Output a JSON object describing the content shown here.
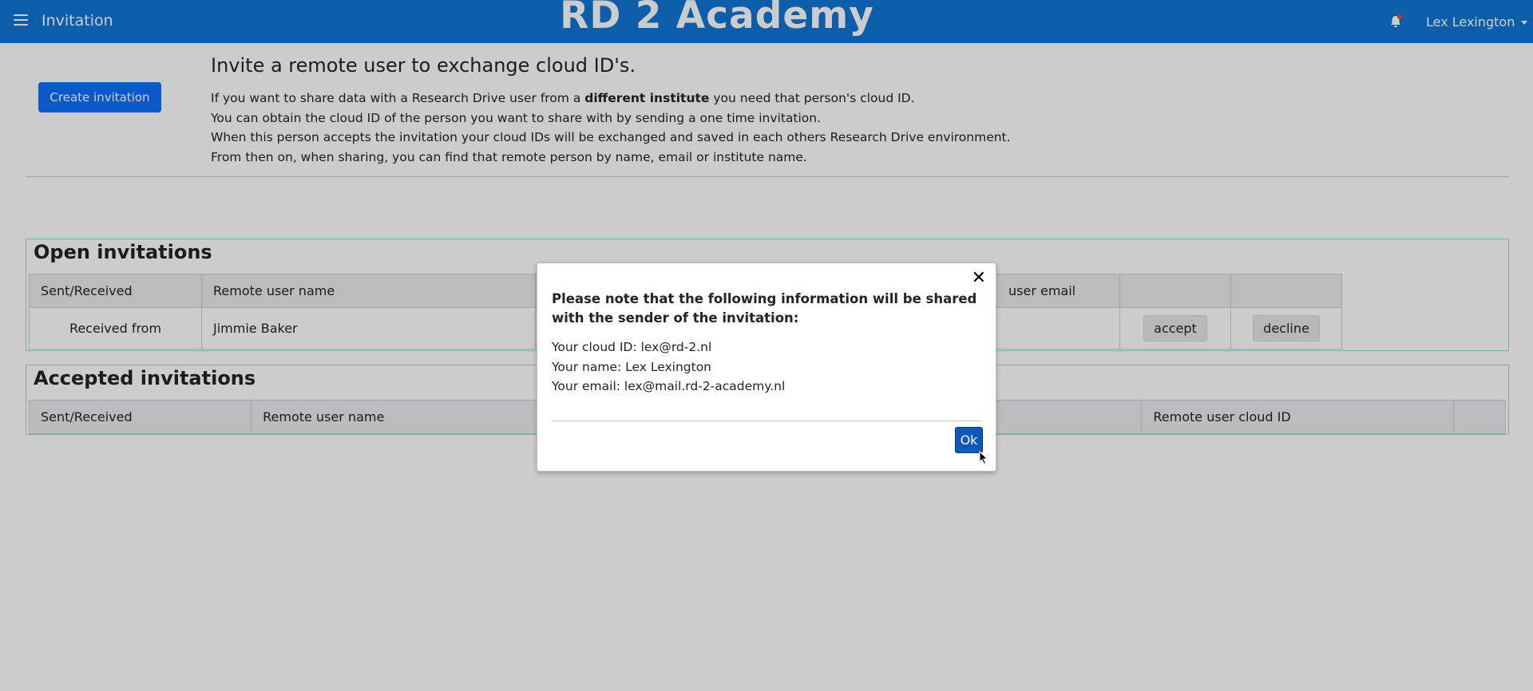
{
  "header": {
    "page_label": "Invitation",
    "brand": "RD 2 Academy",
    "user_name": "Lex Lexington",
    "icons": [
      "hamburger-menu-icon",
      "bell-icon"
    ]
  },
  "invite": {
    "create_button": "Create invitation",
    "title": "Invite a remote user to exchange cloud ID's.",
    "line1_prefix": "If you want to share data with a Research Drive user from a ",
    "line1_bold": "different institute",
    "line1_suffix": " you need that person's cloud ID.",
    "line2": "You can obtain the cloud ID of the person you want to share with by sending a one time invitation.",
    "line3": "When this person accepts the invitation your cloud IDs will be exchanged and saved in each others Research Drive environment.",
    "line4": "From then on, when sharing, you can find that remote person by name, email or institute name."
  },
  "open_invitations": {
    "title": "Open invitations",
    "columns": [
      "Sent/Received",
      "Remote user name",
      "user email",
      "",
      ""
    ],
    "rows": [
      {
        "direction": "Received from",
        "name": "Jimmie Baker",
        "email": "",
        "accept": "accept",
        "decline": "decline"
      }
    ]
  },
  "accepted_invitations": {
    "title": "Accepted invitations",
    "columns": [
      "Sent/Received",
      "Remote user name",
      "",
      "Remote user cloud ID",
      ""
    ]
  },
  "modal": {
    "heading": "Please note that the following information will be shared with the sender of the invitation:",
    "cloud_id": "Your cloud ID: lex@rd-2.nl",
    "name": "Your name: Lex Lexington",
    "email": "Your email: lex@mail.rd-2-academy.nl",
    "close_symbol": "✕",
    "ok_button": "Ok"
  },
  "colors": {
    "header_bg": "#0f76d6",
    "primary_button": "#0d6efd",
    "panel_border": "#9fd4e6",
    "ok_button": "#0e59b8"
  }
}
